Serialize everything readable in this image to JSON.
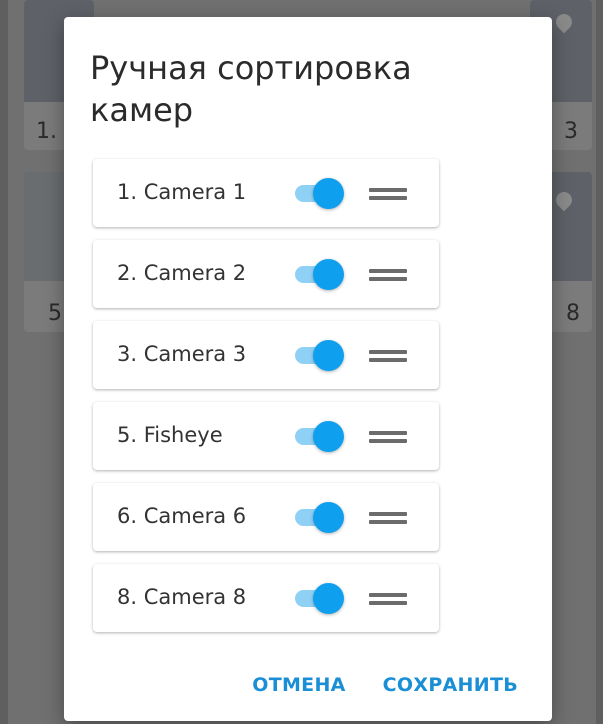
{
  "dialog": {
    "title": "Ручная сортировка камер",
    "cameras": [
      {
        "label": "1. Camera 1",
        "enabled": true
      },
      {
        "label": "2. Camera 2",
        "enabled": true
      },
      {
        "label": "3. Camera 3",
        "enabled": true
      },
      {
        "label": "5. Fisheye",
        "enabled": true
      },
      {
        "label": "6. Camera 6",
        "enabled": true
      },
      {
        "label": "8. Camera 8",
        "enabled": true
      }
    ],
    "cancel_label": "ОТМЕНА",
    "save_label": "СОХРАНИТЬ"
  },
  "background": {
    "tile_numbers": [
      "1.",
      "3",
      "5",
      "8"
    ]
  },
  "colors": {
    "accent": "#1a8fd6",
    "toggle_thumb": "#0ea0ef",
    "toggle_track": "#8fd0f5",
    "overlay": "#707070"
  }
}
